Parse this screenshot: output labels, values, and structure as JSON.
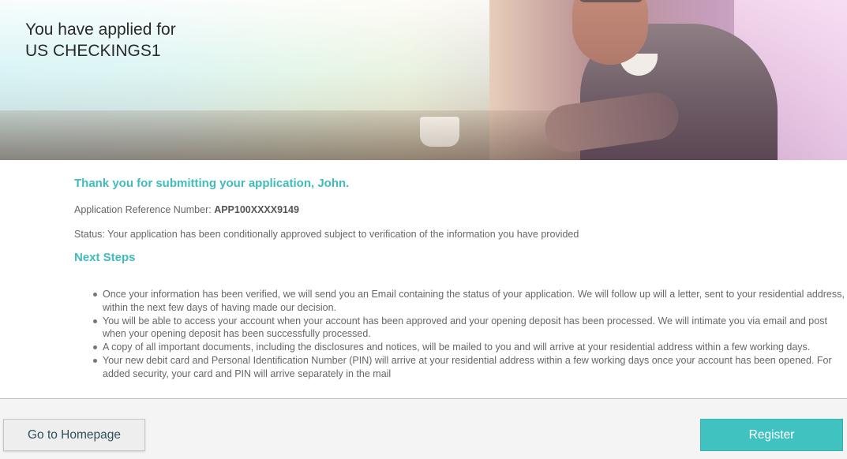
{
  "banner": {
    "title_line1": "You have applied for",
    "title_line2": "US CHECKINGS1"
  },
  "confirmation": {
    "thanks_message": "Thank you for submitting your application, John.",
    "reference_label": "Application Reference Number: ",
    "reference_number": "APP100XXXX9149",
    "status_text": "Status: Your application has been conditionally approved subject to verification of the information you have provided"
  },
  "next_steps": {
    "heading": "Next Steps",
    "items": [
      "Once your information has been verified, we will send you an Email containing the status of your application. We will follow up will a letter, sent to your residential address, within the next few days of having made our decision.",
      "You will be able to access your account when your account has been approved and your opening deposit has been processed. We will intimate you via email and post when your opening deposit has been successfully processed.",
      "A copy of all important documents, including the disclosures and notices, will be mailed to you and will arrive at your residential address within a few working days.",
      "Your new debit card and Personal Identification Number (PIN) will arrive at your residential address within a few working days once your account has been opened. For added security, your card and PIN will arrive separately in the mail"
    ]
  },
  "footer": {
    "homepage_label": "Go to Homepage",
    "register_label": "Register"
  },
  "colors": {
    "accent": "#40c2c0",
    "heading": "#3fbcbc",
    "body_text": "#666666"
  }
}
